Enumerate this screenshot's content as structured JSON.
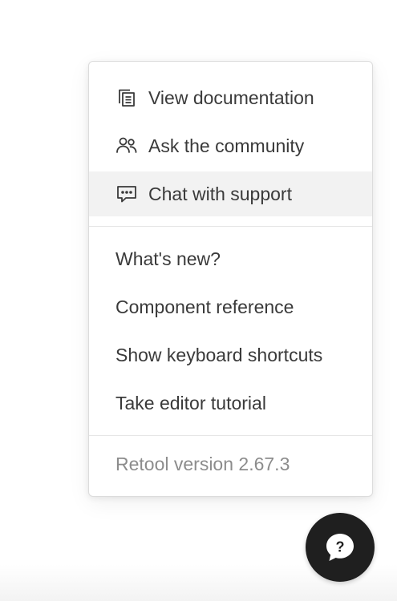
{
  "help_menu": {
    "primary_items": [
      {
        "label": "View documentation",
        "icon": "documentation-icon"
      },
      {
        "label": "Ask the community",
        "icon": "community-icon"
      },
      {
        "label": "Chat with support",
        "icon": "chat-support-icon",
        "highlighted": true
      }
    ],
    "secondary_items": [
      {
        "label": "What's new?"
      },
      {
        "label": "Component reference"
      },
      {
        "label": "Show keyboard shortcuts"
      },
      {
        "label": "Take editor tutorial"
      }
    ],
    "version_text": "Retool version 2.67.3"
  },
  "help_button": {
    "icon": "help-question-icon",
    "glyph": "?"
  },
  "colors": {
    "text": "#3a3a3a",
    "muted_text": "#8c8c8c",
    "highlight_bg": "#f2f2f2",
    "fab_bg": "#1f1f1f",
    "fab_icon": "#ffffff"
  }
}
